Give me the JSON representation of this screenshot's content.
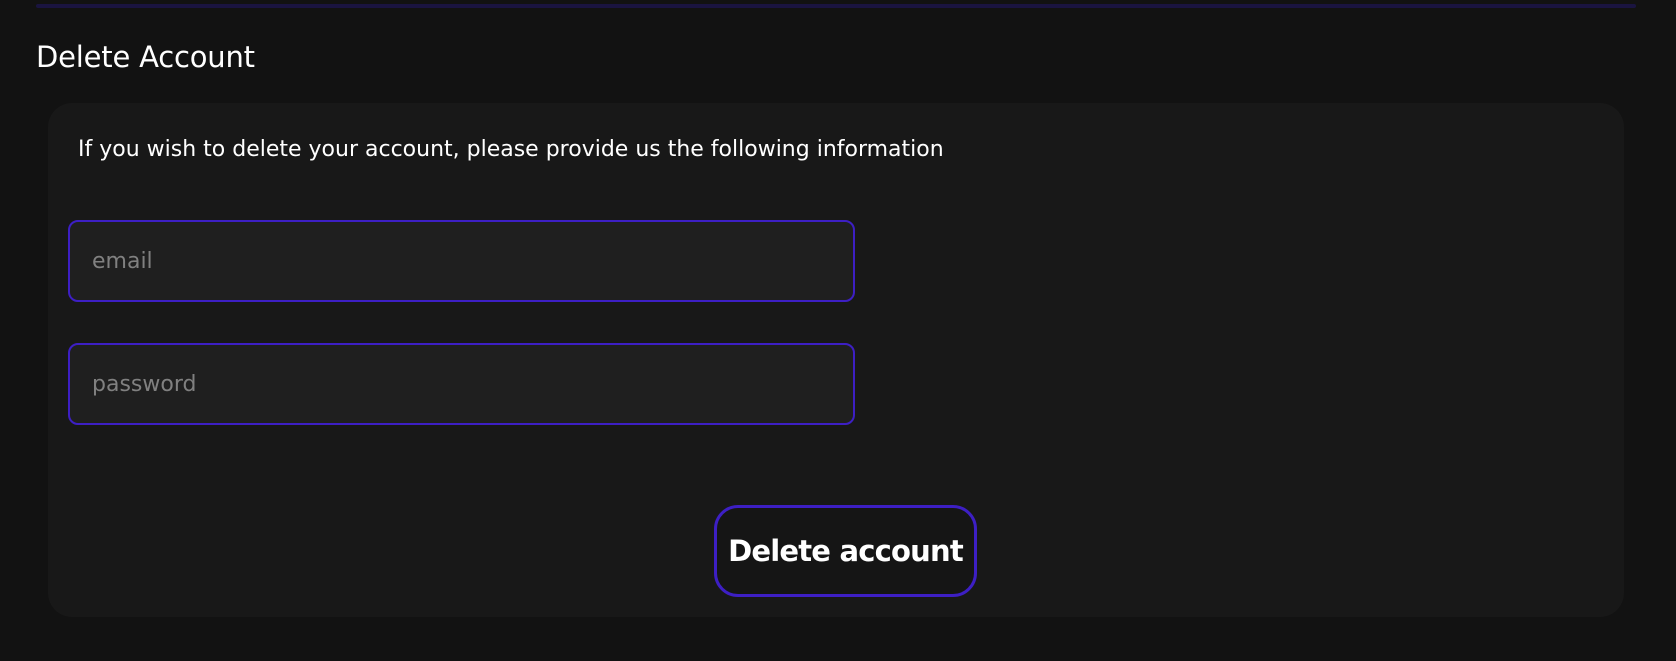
{
  "page": {
    "title": "Delete Account"
  },
  "card": {
    "intro": "If you wish to delete your account, please provide us the following information",
    "email": {
      "value": "",
      "placeholder": "email"
    },
    "password": {
      "value": "",
      "placeholder": "password"
    },
    "submit_label": "Delete account"
  },
  "colors": {
    "background": "#121212",
    "card_background": "#181818",
    "input_background": "#1f1f1f",
    "accent_border": "#3d1fc4",
    "top_rule": "#1a1440",
    "text": "#ffffff",
    "placeholder": "#808080"
  }
}
